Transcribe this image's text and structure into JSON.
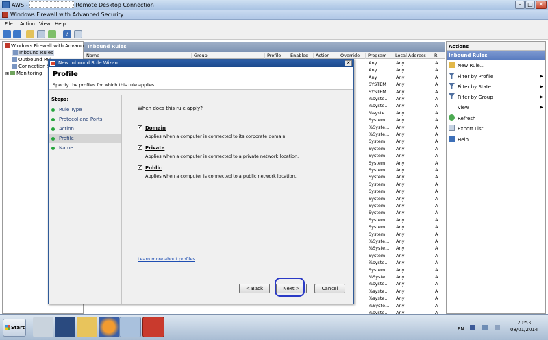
{
  "rdp": {
    "title_prefix": "AWS -",
    "title_suffix": "Remote Desktop Connection"
  },
  "mmc": {
    "title": "Windows Firewall with Advanced Security"
  },
  "menu": [
    "File",
    "Action",
    "View",
    "Help"
  ],
  "tree": {
    "root": "Windows Firewall with Advanced S",
    "items": [
      "Inbound Rules",
      "Outbound Rul",
      "Connection Se",
      "Monitoring"
    ]
  },
  "center": {
    "header": "Inbound Rules",
    "columns": [
      "Name",
      "Group",
      "Profile",
      "Enabled",
      "Action",
      "Override",
      "Program",
      "Local Address",
      "R"
    ],
    "program_values": [
      "Any",
      "Any",
      "Any",
      "SYSTEM",
      "SYSTEM",
      "%syste...",
      "%syste...",
      "%syste...",
      "System",
      "%Syste...",
      "%Syste...",
      "System",
      "System",
      "System",
      "System",
      "System",
      "System",
      "System",
      "System",
      "System",
      "System",
      "System",
      "System",
      "System",
      "System",
      "%Syste...",
      "%Syste...",
      "System",
      "%syste...",
      "System",
      "%Syste...",
      "%syste...",
      "%syste...",
      "%syste...",
      "%Syste...",
      "%syste..."
    ],
    "local_address_values": [
      "Any",
      "Any",
      "Any",
      "Any",
      "Any",
      "Any",
      "Any",
      "Any",
      "Any",
      "Any",
      "Any",
      "Any",
      "Any",
      "Any",
      "Any",
      "Any",
      "Any",
      "Any",
      "Any",
      "Any",
      "Any",
      "Any",
      "Any",
      "Any",
      "Any",
      "Any",
      "Any",
      "Any",
      "Any",
      "Any",
      "Any",
      "Any",
      "Any",
      "Any",
      "Any",
      "Any"
    ]
  },
  "actions": {
    "title": "Actions",
    "section": "Inbound Rules",
    "items": [
      "New Rule...",
      "Filter by Profile",
      "Filter by State",
      "Filter by Group",
      "View",
      "Refresh",
      "Export List...",
      "Help"
    ]
  },
  "wizard": {
    "title": "New Inbound Rule Wizard",
    "heading": "Profile",
    "subheading": "Specify the profiles for which this rule applies.",
    "steps_label": "Steps:",
    "steps": [
      "Rule Type",
      "Protocol and Ports",
      "Action",
      "Profile",
      "Name"
    ],
    "question": "When does this rule apply?",
    "options": [
      {
        "label": "Domain",
        "desc": "Applies when a computer is connected to its corporate domain.",
        "checked": true
      },
      {
        "label": "Private",
        "desc": "Applies when a computer is connected to a private network location.",
        "checked": true
      },
      {
        "label": "Public",
        "desc": "Applies when a computer is connected to a public network location.",
        "checked": true
      }
    ],
    "learn_more": "Learn more about profiles",
    "back": "< Back",
    "next": "Next >",
    "cancel": "Cancel"
  },
  "taskbar": {
    "start": "Start",
    "lang": "EN",
    "time": "20:53",
    "date": "08/01/2014"
  }
}
